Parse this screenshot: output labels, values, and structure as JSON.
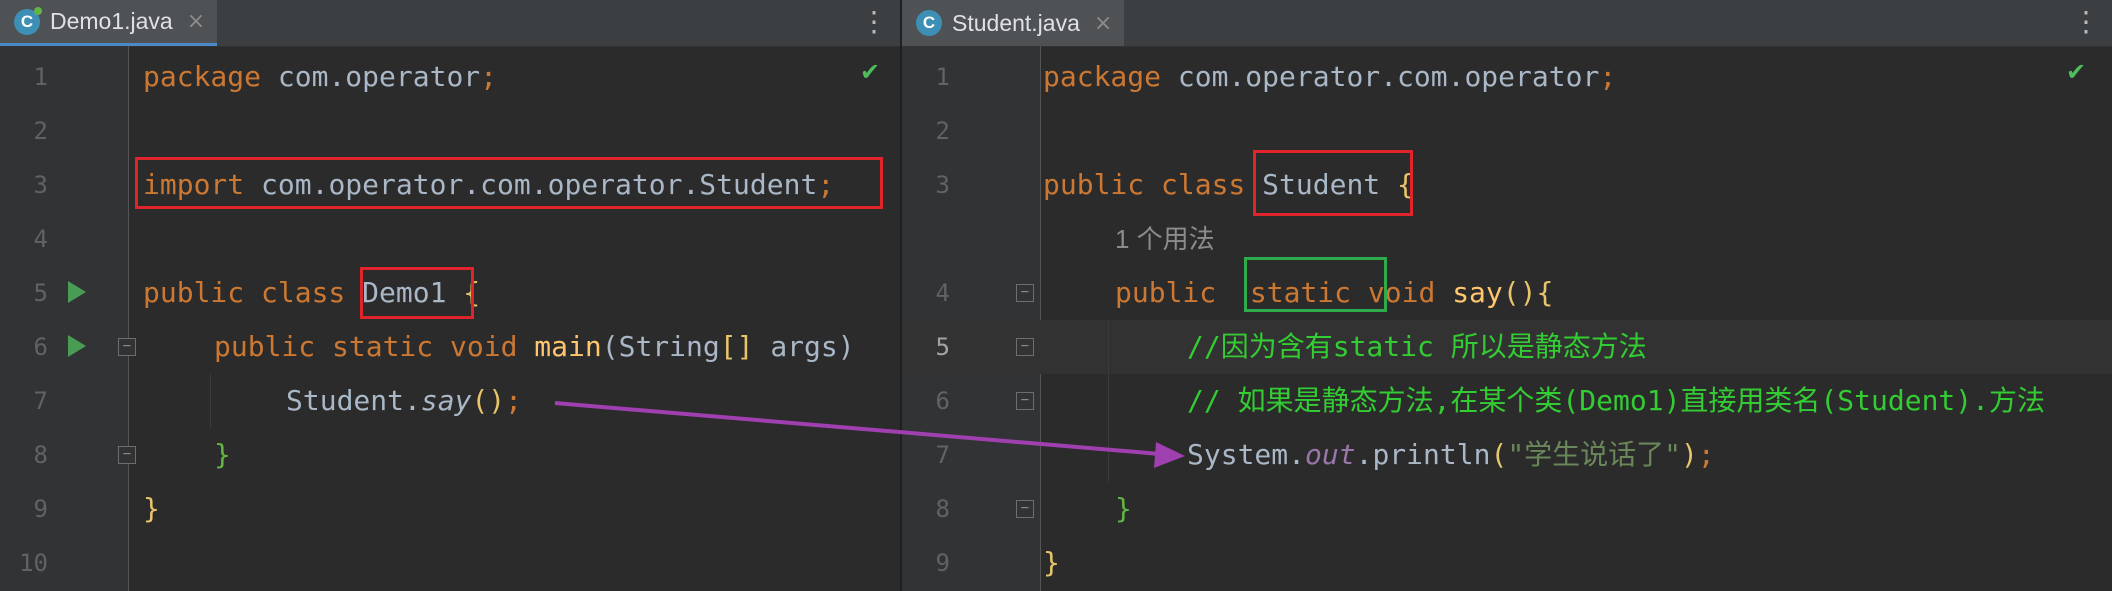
{
  "left_editor": {
    "tab": {
      "icon_letter": "C",
      "name": "Demo1.java",
      "close": "×"
    },
    "menu": "⋮",
    "check": "✔",
    "line_numbers": [
      "1",
      "2",
      "3",
      "4",
      "5",
      "6",
      "7",
      "8",
      "9",
      "10"
    ],
    "code": {
      "l1_kw": "package",
      "l1_rest": " com.operator",
      "l1_semi": ";",
      "l3_kw": "import",
      "l3_rest": " com.operator.com.operator.Student",
      "l3_semi": ";",
      "l5_kw": "public class ",
      "l5_name": "Demo1",
      "l5_brace": " {",
      "l6_kw": "public static void ",
      "l6_fn": "main",
      "l6_open": "(",
      "l6_type": "String",
      "l6_br": "[]",
      "l6_args": " args)",
      "l7_class": "Student.",
      "l7_method": "say",
      "l7_call": "()",
      "l7_semi": ";",
      "l8_brace": "}",
      "l9_brace": "}"
    }
  },
  "right_editor": {
    "tab": {
      "icon_letter": "C",
      "name": "Student.java",
      "close": "×"
    },
    "menu": "⋮",
    "check": "✔",
    "line_numbers": [
      "1",
      "2",
      "3",
      "4",
      "5",
      "6",
      "7",
      "8",
      "9"
    ],
    "usage_hint": "1 个用法",
    "code": {
      "l1_kw": "package",
      "l1_rest": " com.operator.com.operator",
      "l1_semi": ";",
      "l3_kw": "public class ",
      "l3_name": "Student",
      "l3_brace": " {",
      "l4_kw1": "public ",
      "l4_kw2": "static",
      "l4_kw3": " void ",
      "l4_fn": "say",
      "l4_paren": "()",
      "l4_brace": "{",
      "l5_comment": "//因为含有static 所以是静态方法",
      "l6_comment": "// 如果是静态方法,在某个类(Demo1)直接用类名(Student).方法",
      "l7_sys": "System.",
      "l7_out": "out",
      "l7_print": ".println",
      "l7_open": "(",
      "l7_str": "\"学生说话了\"",
      "l7_close": ")",
      "l7_semi": ";",
      "l8_brace": "}",
      "l9_brace": "}"
    }
  },
  "colors": {
    "annotation_red": "#e0242b",
    "annotation_green": "#2eab4a",
    "arrow": "#a040b0"
  }
}
